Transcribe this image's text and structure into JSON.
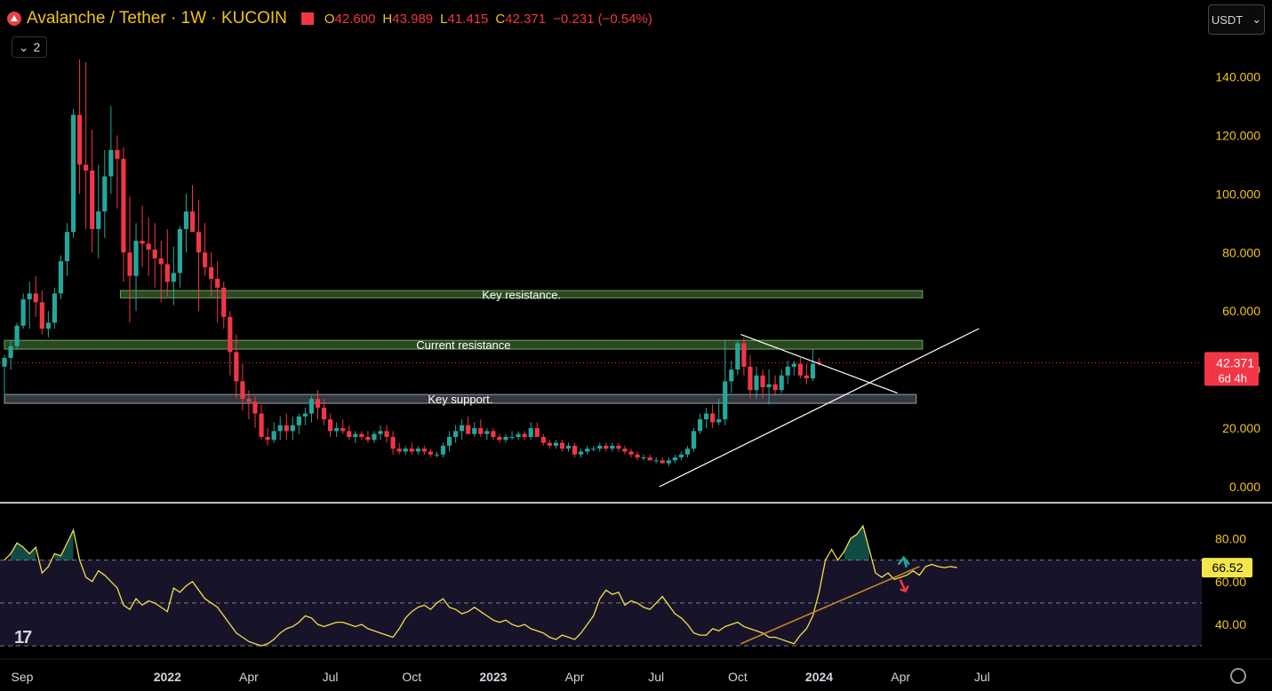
{
  "header": {
    "symbol_title": "Avalanche / Tether · 1W · KUCOIN",
    "open_label": "O",
    "open": "42.600",
    "high_label": "H",
    "high": "43.989",
    "low_label": "L",
    "low": "41.415",
    "close_label": "C",
    "close": "42.371",
    "change": "−0.231 (−0.54%)",
    "collapse_count": "2",
    "currency_button": "USDT",
    "chevron_icon": "chevron-down-icon",
    "logo_icon": "avalanche-logo-icon",
    "watermark": "17",
    "settings_icon": "gear-icon"
  },
  "colors": {
    "up": "#26a69a",
    "down": "#f23645",
    "text_yellow": "#f0c419",
    "rsi_line": "#f5dd4d",
    "rsi_band": "#1b1730",
    "zone_fill": "#31552a",
    "zone_border": "#6fa84a",
    "support_fill": "#3a3e46",
    "trend": "#ffffff",
    "rsi_trend": "#d08b24"
  },
  "chart_data": [
    {
      "type": "candlestick",
      "ylim": [
        0,
        145
      ],
      "y_ticks": [
        "140.000",
        "120.000",
        "100.000",
        "80.000",
        "60.000",
        "40.000",
        "20.000",
        "0.000"
      ],
      "y_tick_values": [
        140,
        120,
        100,
        80,
        60,
        40,
        20,
        0
      ],
      "x_ticks": [
        "Sep",
        "2022",
        "Apr",
        "Jul",
        "Oct",
        "2023",
        "Apr",
        "Jul",
        "Oct",
        "2024",
        "Apr",
        "Jul"
      ],
      "x_tick_weeks": [
        0,
        26,
        39,
        52,
        65,
        78,
        91,
        104,
        117,
        130,
        143,
        156
      ],
      "last_price": "42.371",
      "countdown": "6d 4h",
      "zones": [
        {
          "label": "Key resistance.",
          "low": 64.5,
          "high": 67,
          "from_week": 18.5,
          "to_week": 146.5,
          "fill": "zone"
        },
        {
          "label": "Current resistance",
          "low": 47,
          "high": 50,
          "from_week": 0,
          "to_week": 146.5,
          "fill": "zone"
        },
        {
          "label": "Key support.",
          "low": 28.5,
          "high": 31.5,
          "from_week": 0,
          "to_week": 145.5,
          "fill": "support"
        }
      ],
      "trendlines": [
        {
          "from": [
            104.5,
            0
          ],
          "to": [
            155.5,
            54
          ]
        },
        {
          "from": [
            117.5,
            52
          ],
          "to": [
            142.5,
            32
          ]
        }
      ],
      "candles": [
        [
          41,
          45,
          31,
          44
        ],
        [
          44,
          50,
          40,
          48
        ],
        [
          48,
          56,
          47,
          55
        ],
        [
          55,
          66,
          54,
          64
        ],
        [
          64,
          70,
          54,
          66
        ],
        [
          66,
          72,
          58,
          63
        ],
        [
          63,
          67,
          52,
          54
        ],
        [
          54,
          60,
          51,
          56
        ],
        [
          56,
          68,
          54,
          66
        ],
        [
          66,
          79,
          64,
          77
        ],
        [
          77,
          90,
          72,
          87
        ],
        [
          87,
          129,
          85,
          127
        ],
        [
          127,
          146,
          100,
          110
        ],
        [
          110,
          145,
          88,
          108
        ],
        [
          108,
          122,
          80,
          88
        ],
        [
          88,
          110,
          78,
          94
        ],
        [
          94,
          115,
          85,
          106
        ],
        [
          106,
          130,
          100,
          115
        ],
        [
          115,
          120,
          95,
          112
        ],
        [
          112,
          116,
          70,
          80
        ],
        [
          80,
          99,
          56,
          72
        ],
        [
          72,
          90,
          60,
          84
        ],
        [
          84,
          96,
          75,
          83
        ],
        [
          83,
          92,
          72,
          81
        ],
        [
          81,
          90,
          68,
          78
        ],
        [
          78,
          84,
          63,
          76
        ],
        [
          76,
          88,
          65,
          70
        ],
        [
          70,
          82,
          62,
          73
        ],
        [
          73,
          89,
          68,
          88
        ],
        [
          88,
          100,
          80,
          94
        ],
        [
          94,
          103,
          88,
          87
        ],
        [
          87,
          98,
          60,
          80
        ],
        [
          80,
          90,
          72,
          75
        ],
        [
          75,
          80,
          65,
          71
        ],
        [
          71,
          77,
          56,
          68
        ],
        [
          68,
          70,
          54,
          58
        ],
        [
          58,
          60,
          38,
          46
        ],
        [
          46,
          52,
          30,
          36
        ],
        [
          36,
          42,
          26,
          30
        ],
        [
          30,
          33,
          23,
          29
        ],
        [
          29,
          31,
          20,
          25
        ],
        [
          25,
          28,
          16,
          17
        ],
        [
          17,
          20,
          14,
          16
        ],
        [
          16,
          22,
          15,
          19
        ],
        [
          19,
          24,
          16,
          21
        ],
        [
          21,
          25,
          16,
          19
        ],
        [
          19,
          24,
          16,
          21
        ],
        [
          21,
          25,
          18,
          24
        ],
        [
          24,
          27,
          21,
          25
        ],
        [
          25,
          31,
          22,
          30
        ],
        [
          30,
          33,
          23,
          27
        ],
        [
          27,
          30,
          21,
          23
        ],
        [
          23,
          25,
          17,
          19
        ],
        [
          19,
          22,
          17,
          20
        ],
        [
          20,
          23,
          18,
          19
        ],
        [
          19,
          21,
          16,
          17
        ],
        [
          17,
          19,
          15,
          18
        ],
        [
          18,
          19,
          16,
          17
        ],
        [
          17,
          19,
          15,
          16
        ],
        [
          16,
          19,
          15,
          18
        ],
        [
          18,
          21,
          16,
          19
        ],
        [
          19,
          21,
          15,
          17
        ],
        [
          17,
          19,
          11,
          13
        ],
        [
          13,
          15,
          11,
          12
        ],
        [
          12,
          14,
          11,
          13
        ],
        [
          13,
          15,
          11,
          12
        ],
        [
          12,
          14,
          11,
          13
        ],
        [
          13,
          14,
          11,
          12
        ],
        [
          12,
          13,
          10,
          11
        ],
        [
          11,
          12,
          10,
          11
        ],
        [
          11,
          15,
          10,
          14
        ],
        [
          14,
          19,
          12,
          17
        ],
        [
          17,
          21,
          15,
          19
        ],
        [
          19,
          23,
          16,
          21
        ],
        [
          21,
          24,
          19,
          18
        ],
        [
          18,
          22,
          17,
          20
        ],
        [
          20,
          23,
          17,
          18
        ],
        [
          18,
          20,
          16,
          19
        ],
        [
          19,
          20,
          16,
          17
        ],
        [
          17,
          18,
          15,
          16
        ],
        [
          16,
          18,
          15,
          17
        ],
        [
          17,
          19,
          16,
          17
        ],
        [
          17,
          19,
          16,
          18
        ],
        [
          18,
          19,
          16,
          17
        ],
        [
          17,
          22,
          16,
          20
        ],
        [
          20,
          22,
          17,
          17
        ],
        [
          17,
          18,
          14,
          15
        ],
        [
          15,
          16,
          13,
          14
        ],
        [
          14,
          16,
          13,
          15
        ],
        [
          15,
          16,
          12,
          13
        ],
        [
          13,
          15,
          12,
          14
        ],
        [
          14,
          15,
          10,
          11
        ],
        [
          11,
          13,
          10,
          12
        ],
        [
          12,
          14,
          11,
          13
        ],
        [
          13,
          14,
          12,
          13
        ],
        [
          13,
          15,
          12,
          14
        ],
        [
          14,
          15,
          12,
          13
        ],
        [
          13,
          15,
          12,
          14
        ],
        [
          14,
          15,
          12,
          13
        ],
        [
          13,
          14,
          11,
          12
        ],
        [
          12,
          13,
          10,
          11
        ],
        [
          11,
          12,
          9,
          10
        ],
        [
          10,
          11,
          9,
          10
        ],
        [
          10,
          11,
          9,
          9
        ],
        [
          9,
          10,
          8,
          9
        ],
        [
          9,
          10,
          8,
          8
        ],
        [
          8,
          10,
          7,
          9
        ],
        [
          9,
          11,
          8,
          10
        ],
        [
          10,
          12,
          9,
          11
        ],
        [
          11,
          14,
          10,
          13
        ],
        [
          13,
          20,
          12,
          19
        ],
        [
          19,
          25,
          18,
          23
        ],
        [
          23,
          27,
          20,
          25
        ],
        [
          25,
          28,
          20,
          22
        ],
        [
          22,
          30,
          21,
          23
        ],
        [
          23,
          50,
          21,
          36
        ],
        [
          36,
          43,
          32,
          40
        ],
        [
          40,
          50,
          38,
          49
        ],
        [
          49,
          51,
          38,
          41
        ],
        [
          41,
          45,
          30,
          33
        ],
        [
          33,
          41,
          30,
          38
        ],
        [
          38,
          40,
          30,
          34
        ],
        [
          34,
          40,
          28,
          35
        ],
        [
          35,
          38,
          31,
          33
        ],
        [
          33,
          40,
          32,
          38
        ],
        [
          38,
          43,
          35,
          41
        ],
        [
          41,
          43,
          38,
          42
        ],
        [
          42,
          44,
          37,
          38
        ],
        [
          38,
          42,
          35,
          37
        ],
        [
          37,
          47,
          36,
          42
        ],
        [
          42.6,
          43.989,
          41.415,
          42.371
        ]
      ]
    },
    {
      "type": "line",
      "name": "RSI",
      "ylim": [
        28,
        91
      ],
      "y_ticks": [
        "80.00",
        "60.00",
        "40.00"
      ],
      "y_tick_values": [
        80,
        60,
        40
      ],
      "bands": [
        30,
        50,
        70
      ],
      "current": "66.52",
      "values": [
        70,
        73,
        78,
        76,
        73,
        76,
        64,
        67,
        73,
        72,
        78,
        84,
        70,
        62,
        60,
        65,
        63,
        60,
        57,
        49,
        47,
        52,
        49,
        51,
        50,
        48,
        46,
        57,
        55,
        58,
        60,
        56,
        52,
        50,
        48,
        44,
        40,
        36,
        34,
        32,
        31,
        30,
        31,
        33,
        36,
        38,
        39,
        41,
        44,
        43,
        40,
        39,
        40,
        41,
        41,
        40,
        39,
        40,
        38,
        37,
        36,
        35,
        34,
        38,
        43,
        46,
        48,
        49,
        47,
        50,
        52,
        48,
        47,
        45,
        46,
        48,
        46,
        44,
        42,
        41,
        42,
        40,
        39,
        40,
        38,
        37,
        36,
        34,
        33,
        35,
        34,
        33,
        36,
        40,
        44,
        52,
        56,
        54,
        55,
        49,
        51,
        50,
        48,
        47,
        50,
        53,
        49,
        45,
        43,
        40,
        36,
        35,
        35,
        38,
        37,
        39,
        40,
        41,
        39,
        38,
        37,
        36,
        34,
        34,
        33,
        32,
        31,
        35,
        38,
        44,
        55,
        70,
        75,
        70,
        74,
        80,
        82,
        86,
        75,
        64,
        62,
        64,
        61,
        62,
        63,
        65,
        63,
        67,
        68,
        67,
        66.5,
        67,
        66.52
      ],
      "trendline": {
        "from": [
          117.5,
          31
        ],
        "to": [
          146,
          67
        ]
      },
      "arrow_up_color": "#26a69a",
      "arrow_down_color": "#f23645"
    }
  ]
}
